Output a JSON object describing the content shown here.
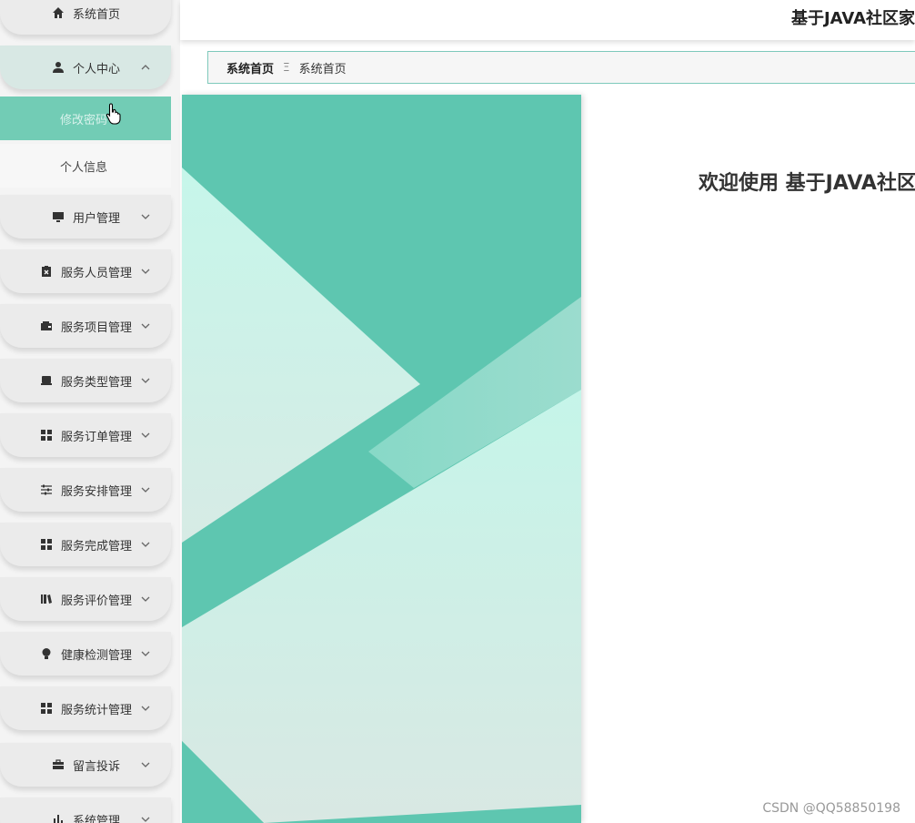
{
  "app": {
    "header_title": "基于JAVA社区家",
    "welcome_text": "欢迎使用 基于JAVA社区"
  },
  "breadcrumb": {
    "first": "系统首页",
    "separator": "Ξ",
    "second": "系统首页"
  },
  "sidebar": {
    "items": [
      {
        "label": "系统首页",
        "icon": "home-icon"
      },
      {
        "label": "个人中心",
        "icon": "user-icon",
        "expanded": true
      },
      {
        "label": "用户管理",
        "icon": "monitor-icon"
      },
      {
        "label": "服务人员管理",
        "icon": "clipboard-x-icon"
      },
      {
        "label": "服务项目管理",
        "icon": "wallet-icon"
      },
      {
        "label": "服务类型管理",
        "icon": "tray-icon"
      },
      {
        "label": "服务订单管理",
        "icon": "grid-icon"
      },
      {
        "label": "服务安排管理",
        "icon": "sliders-icon"
      },
      {
        "label": "服务完成管理",
        "icon": "grid-icon"
      },
      {
        "label": "服务评价管理",
        "icon": "books-icon"
      },
      {
        "label": "健康检测管理",
        "icon": "bulb-icon"
      },
      {
        "label": "服务统计管理",
        "icon": "grid-icon"
      },
      {
        "label": "留言投诉",
        "icon": "briefcase-icon"
      },
      {
        "label": "系统管理",
        "icon": "bar-chart-icon"
      }
    ],
    "sub_items": [
      {
        "label": "修改密码",
        "active": true
      },
      {
        "label": "个人信息",
        "active": false
      }
    ]
  },
  "watermark": "CSDN @QQ58850198",
  "colors": {
    "accent": "#5ec6b0",
    "accent_light": "#c6f4ea",
    "active_sub": "#72ccb5"
  }
}
